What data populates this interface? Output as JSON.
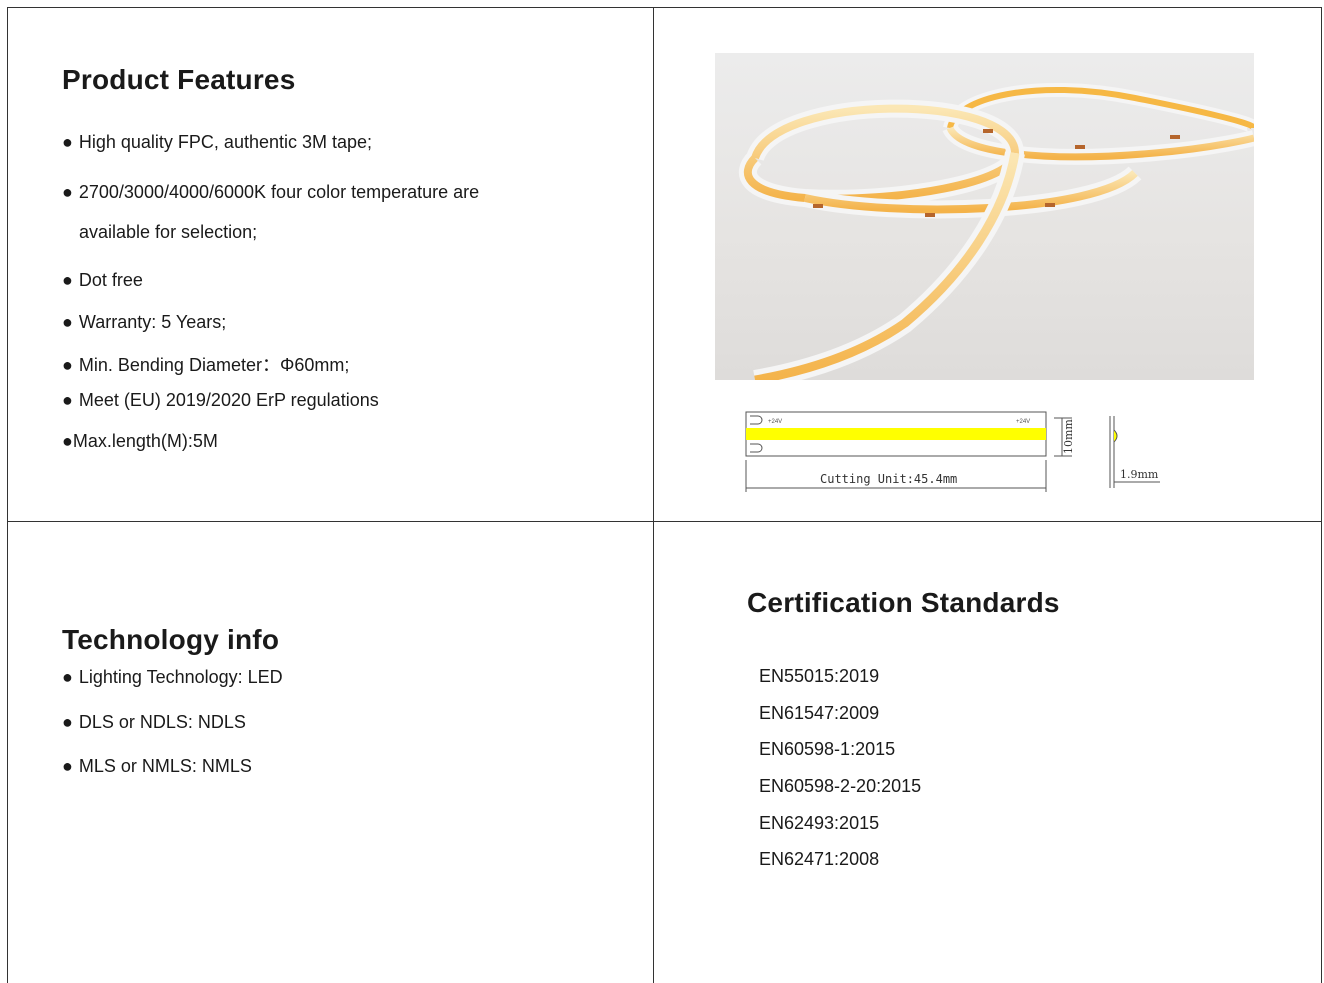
{
  "features": {
    "title": "Product Features",
    "items": [
      "High quality FPC, authentic 3M tape;",
      "2700/3000/4000/6000K four color temperature are",
      "available for selection;",
      "Dot free",
      "Warranty: 5 Years;",
      "Min. Bending Diameter：Φ60mm;",
      "Meet (EU) 2019/2020 ErP regulations",
      "Max.length(M):5M"
    ],
    "bullet": "●"
  },
  "diagram": {
    "label_left": "+24V",
    "label_right": "+24V",
    "cutting_unit": "Cutting Unit:45.4mm",
    "width_label": "10mm",
    "thickness_label": "1.9mm"
  },
  "technology": {
    "title": "Technology info",
    "items": [
      "Lighting Technology: LED",
      "DLS or NDLS: NDLS",
      "MLS or NMLS: NMLS"
    ]
  },
  "certification": {
    "title": "Certification Standards",
    "items": [
      "EN55015:2019",
      "EN61547:2009",
      "EN60598-1:2015",
      "EN60598-2-20:2015",
      "EN62493:2015",
      "EN62471:2008"
    ]
  },
  "colors": {
    "strip_yellow": "#f7c24a",
    "diagram_yellow": "#ffff00",
    "border": "#333333"
  }
}
